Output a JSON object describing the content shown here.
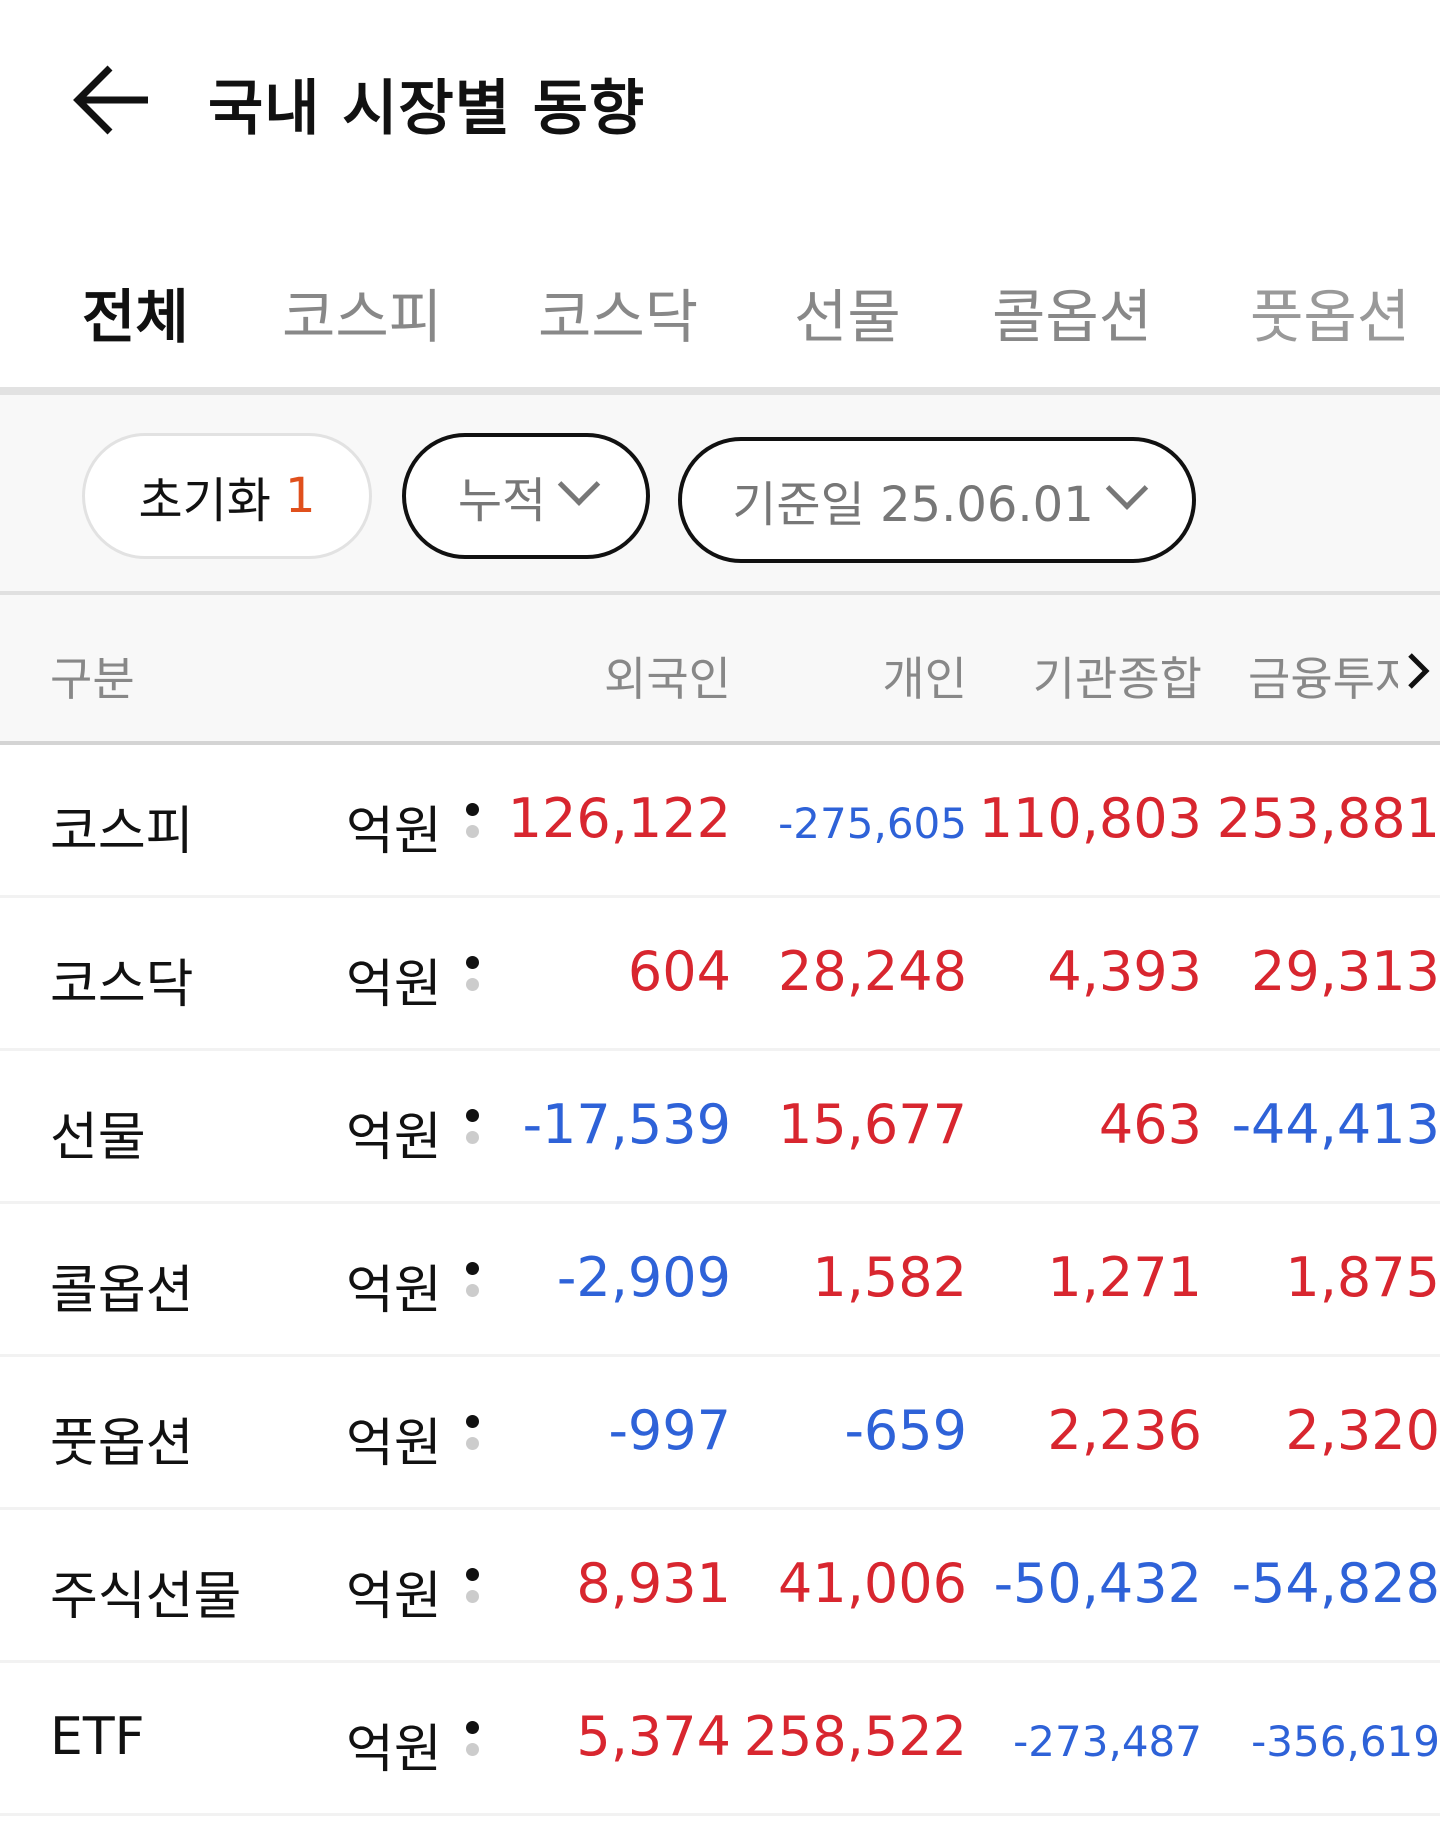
{
  "header": {
    "title": "국내 시장별 동향"
  },
  "tabs": [
    "전체",
    "코스피",
    "코스닥",
    "선물",
    "콜옵션",
    "풋옵션"
  ],
  "filters": {
    "reset_label": "초기화",
    "reset_count": "1",
    "mode": "누적",
    "date": "기준일 25.06.01"
  },
  "table": {
    "headers": [
      "구분",
      "외국인",
      "개인",
      "기관종합",
      "금융투자"
    ],
    "unit": "억원",
    "rows": [
      {
        "label": "코스피",
        "values": [
          "126,122",
          "-275,605",
          "110,803",
          "253,881"
        ]
      },
      {
        "label": "코스닥",
        "values": [
          "604",
          "28,248",
          "4,393",
          "29,313"
        ]
      },
      {
        "label": "선물",
        "values": [
          "-17,539",
          "15,677",
          "463",
          "-44,413"
        ]
      },
      {
        "label": "콜옵션",
        "values": [
          "-2,909",
          "1,582",
          "1,271",
          "1,875"
        ]
      },
      {
        "label": "풋옵션",
        "values": [
          "-997",
          "-659",
          "2,236",
          "2,320"
        ]
      },
      {
        "label": "주식선물",
        "values": [
          "8,931",
          "41,006",
          "-50,432",
          "-54,828"
        ]
      },
      {
        "label": "ETF",
        "values": [
          "5,374",
          "258,522",
          "-273,487",
          "-356,619"
        ]
      }
    ]
  },
  "colors": {
    "positive": "#d8262f",
    "negative": "#2e62d8",
    "accent": "#e0501c"
  }
}
